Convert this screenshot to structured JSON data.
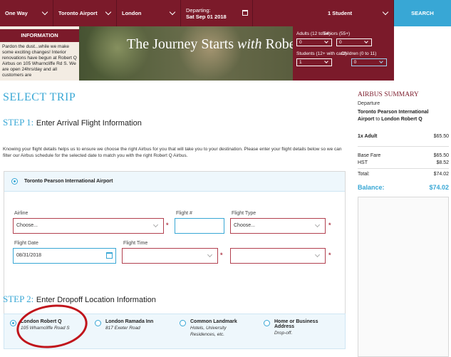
{
  "topbar": {
    "trip_type": "One Way",
    "origin": "Toronto Airport",
    "destination": "London",
    "departing_label": "Departing:",
    "departing_date": "Sat Sep 01 2018",
    "passengers": "1 Student",
    "search_label": "SEARCH"
  },
  "info": {
    "title": "INFORMATION",
    "body": "Pardon the dust...while we make some exciting changes! Interior renovations have begun at Robert Q Airbus on 105 Wharncliffe Rd S. We are open 24hrs/day and all customers are"
  },
  "hero": {
    "title_pre": "The Journey Starts ",
    "title_em": "with",
    "title_post": " Robe"
  },
  "pax": {
    "adults_label": "Adults (12 to 54)",
    "seniors_label": "Seniors (55+)",
    "adults_value": "0",
    "seniors_value": "0",
    "students_label": "Students (12+ with card)",
    "children_label": "Children (0 to 11)",
    "students_value": "1",
    "children_value": "0"
  },
  "main": {
    "title": "SELECT TRIP",
    "step1_num": "STEP 1:",
    "step1_text": "Enter Arrival Flight Information",
    "intro": "Knowing your flight details helps us to ensure we choose the right Airbus for you that will take you to your destination. Please enter your flight details below so we can filter our Airbus schedule for the selected date to match you with the right Robert Q Airbus.",
    "airport_option": "Toronto Pearson International Airport",
    "airline_label": "Airline",
    "airline_value": "Choose...",
    "flight_num_label": "Flight #",
    "flight_num_value": "",
    "flight_type_label": "Flight Type",
    "flight_type_value": "Choose...",
    "flight_date_label": "Flight Date",
    "flight_date_value": "08/31/2018",
    "flight_time_label": "Flight Time",
    "flight_time_value": "",
    "ampm_value": "",
    "step2_num": "STEP 2:",
    "step2_text": "Enter Dropoff Location Information",
    "dropoffs": [
      {
        "title": "London Robert Q",
        "sub": "105 Wharncliffe Road S"
      },
      {
        "title": "London Ramada Inn",
        "sub": "817 Exeter Road"
      },
      {
        "title": "Common Landmark",
        "sub": "Hotels, University Residences, etc."
      },
      {
        "title": "Home or Business Address",
        "sub": "Drop-off."
      }
    ]
  },
  "summary": {
    "title": "AIRBUS SUMMARY",
    "departure_label": "Departure",
    "from": "Toronto Pearson International Airport",
    "to_word": "to",
    "to": "London Robert Q",
    "item_label": "1x Adult",
    "item_price": "$65.50",
    "base_fare_label": "Base Fare",
    "base_fare": "$65.50",
    "hst_label": "HST",
    "hst": "$8.52",
    "total_label": "Total:",
    "total": "$74.02",
    "balance_label": "Balance:",
    "balance": "$74.02"
  },
  "colors": {
    "brand": "#7b1a2a",
    "accent": "#38a7d5",
    "required": "#b2404f",
    "annotation_circle": "#c0141b"
  }
}
